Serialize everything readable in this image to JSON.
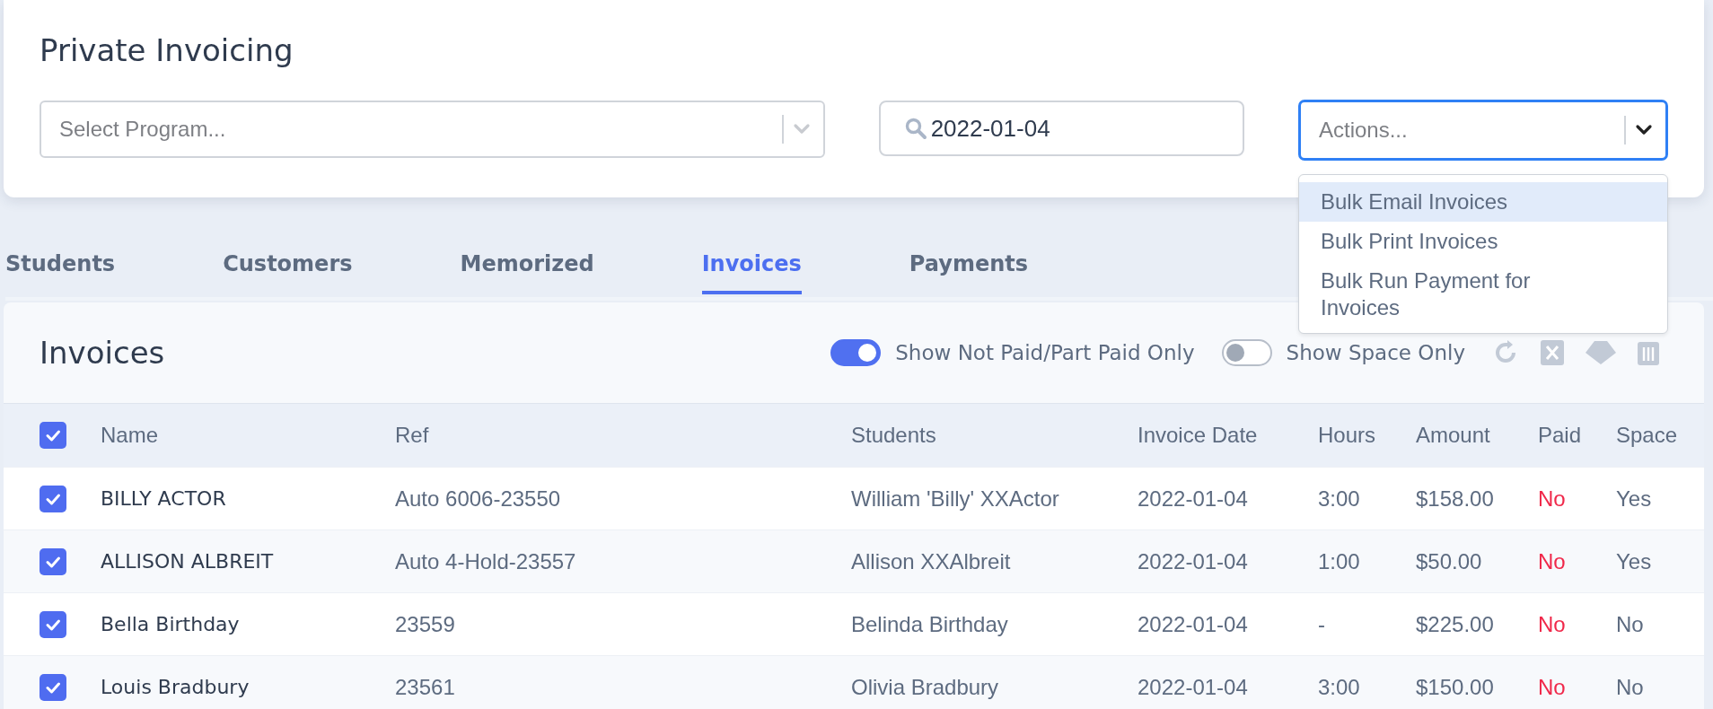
{
  "header": {
    "title": "Private Invoicing",
    "program_select": {
      "placeholder": "Select Program..."
    },
    "search": {
      "value": "2022-01-04"
    },
    "actions_select": {
      "placeholder": "Actions...",
      "focused": true,
      "expanded": true,
      "options": [
        {
          "label": "Bulk Email Invoices",
          "selected": true
        },
        {
          "label": "Bulk Print Invoices",
          "selected": false
        },
        {
          "label": "Bulk Run Payment for Invoices",
          "selected": false
        }
      ]
    }
  },
  "tabs": [
    {
      "label": "Students",
      "selected": false
    },
    {
      "label": "Customers",
      "selected": false
    },
    {
      "label": "Memorized",
      "selected": false
    },
    {
      "label": "Invoices",
      "selected": true
    },
    {
      "label": "Payments",
      "selected": false
    }
  ],
  "panel": {
    "title": "Invoices",
    "toggles": [
      {
        "label": "Show Not Paid/Part Paid Only",
        "on": true
      },
      {
        "label": "Show Space Only",
        "on": false
      }
    ],
    "table": {
      "all_selected": true,
      "columns": [
        "Name",
        "Ref",
        "Students",
        "Invoice Date",
        "Hours",
        "Amount",
        "Paid",
        "Space"
      ],
      "rows": [
        {
          "selected": true,
          "name": "BILLY ACTOR",
          "ref": "Auto 6006-23550",
          "students": "William 'Billy' XXActor",
          "invoice_date": "2022-01-04",
          "hours": "3:00",
          "amount": "$158.00",
          "paid": "No",
          "is_paid": false,
          "space": "Yes"
        },
        {
          "selected": true,
          "name": "ALLISON ALBREIT",
          "ref": "Auto 4-Hold-23557",
          "students": "Allison XXAlbreit",
          "invoice_date": "2022-01-04",
          "hours": "1:00",
          "amount": "$50.00",
          "paid": "No",
          "is_paid": false,
          "space": "Yes"
        },
        {
          "selected": true,
          "name": "Bella Birthday",
          "ref": "23559",
          "students": "Belinda Birthday",
          "invoice_date": "2022-01-04",
          "hours": "-",
          "amount": "$225.00",
          "paid": "No",
          "is_paid": false,
          "space": "No"
        },
        {
          "selected": true,
          "name": "Louis Bradbury",
          "ref": "23561",
          "students": "Olivia Bradbury",
          "invoice_date": "2022-01-04",
          "hours": "3:00",
          "amount": "$150.00",
          "paid": "No",
          "is_paid": false,
          "space": "No"
        }
      ]
    }
  }
}
